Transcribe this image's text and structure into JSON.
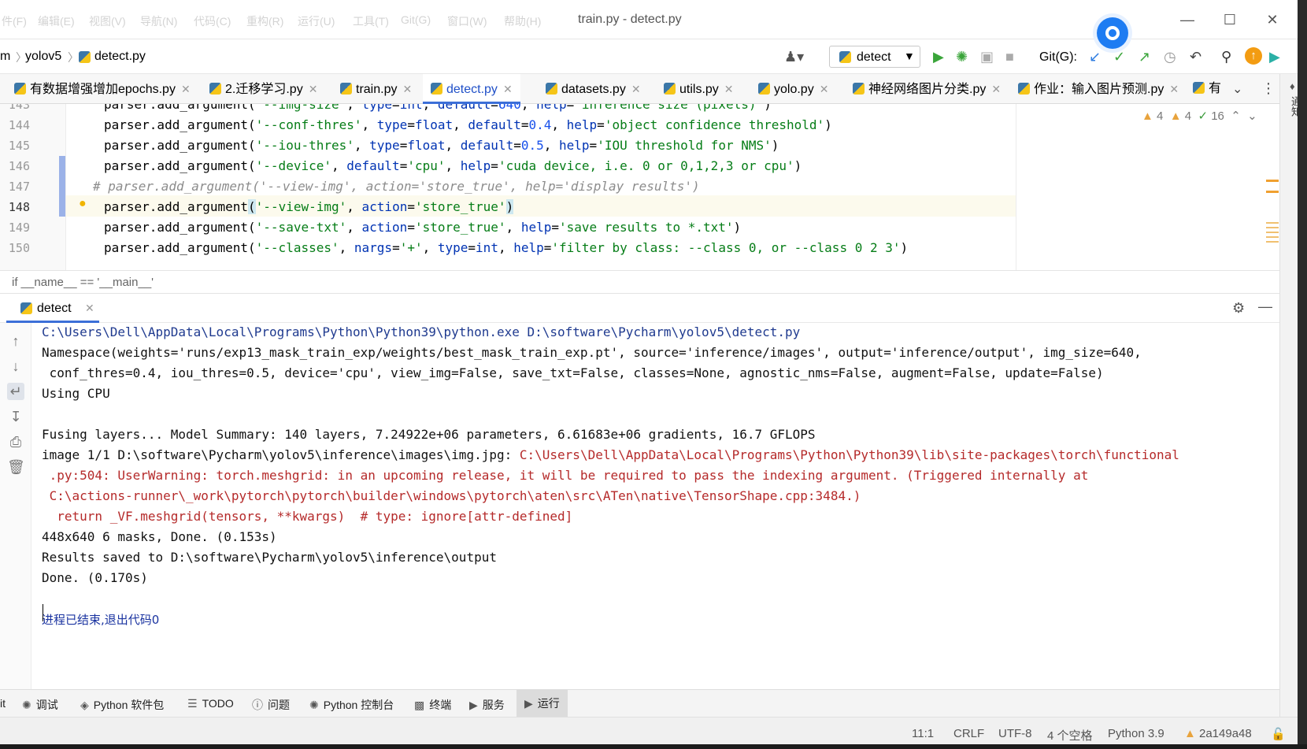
{
  "window": {
    "title": "train.py - detect.py",
    "menu": [
      "件(F)",
      "编辑(E)",
      "视图(V)",
      "导航(N)",
      "代码(C)",
      "重构(R)",
      "运行(U)",
      "工具(T)",
      "Git(G)",
      "窗口(W)",
      "帮助(H)"
    ]
  },
  "navbar": {
    "breadcrumb": [
      "m",
      "yolov5",
      "detect.py"
    ],
    "run_config": "detect",
    "git_label": "Git(G):"
  },
  "tabs": [
    {
      "label": "有数据增强增加epochs.py",
      "active": false
    },
    {
      "label": "2.迁移学习.py",
      "active": false
    },
    {
      "label": "train.py",
      "active": false
    },
    {
      "label": "detect.py",
      "active": true
    },
    {
      "label": "datasets.py",
      "active": false
    },
    {
      "label": "utils.py",
      "active": false
    },
    {
      "label": "yolo.py",
      "active": false
    },
    {
      "label": "神经网络图片分类.py",
      "active": false
    },
    {
      "label": "作业：输入图片预测.py",
      "active": false
    },
    {
      "label": "有",
      "active": false
    }
  ],
  "editor": {
    "line_numbers": [
      "143",
      "144",
      "145",
      "146",
      "147",
      "148",
      "149",
      "150"
    ],
    "inspections": {
      "warnings_a": "4",
      "warnings_b": "4",
      "ok": "16"
    },
    "breadcrumb": "if __name__ == '__main__'"
  },
  "run": {
    "tab_label": "detect",
    "console": {
      "line1": "C:\\Users\\Dell\\AppData\\Local\\Programs\\Python\\Python39\\python.exe D:\\software\\Pycharm\\yolov5\\detect.py",
      "line2": "Namespace(weights='runs/exp13_mask_train_exp/weights/best_mask_train_exp.pt', source='inference/images', output='inference/output', img_size=640,",
      "line3": " conf_thres=0.4, iou_thres=0.5, device='cpu', view_img=False, save_txt=False, classes=None, agnostic_nms=False, augment=False, update=False)",
      "line4": "Using CPU",
      "line5": "Fusing layers... Model Summary: 140 layers, 7.24922e+06 parameters, 6.61683e+06 gradients, 16.7 GFLOPS",
      "line6a": "image 1/1 D:\\software\\Pycharm\\yolov5\\inference\\images\\img.jpg: ",
      "line6b": "C:\\Users\\Dell\\AppData\\Local\\Programs\\Python\\Python39\\lib\\site-packages\\torch\\functional",
      "line7": " .py:504: UserWarning: torch.meshgrid: in an upcoming release, it will be required to pass the indexing argument. (Triggered internally at",
      "line8": " C:\\actions-runner\\_work\\pytorch\\pytorch\\builder\\windows\\pytorch\\aten\\src\\ATen\\native\\TensorShape.cpp:3484.)",
      "line9": "  return _VF.meshgrid(tensors, **kwargs)  # type: ignore[attr-defined]",
      "line10": "448x640 6 masks, Done. (0.153s)",
      "line11": "Results saved to D:\\software\\Pycharm\\yolov5\\inference\\output",
      "line12": "Done. (0.170s)",
      "exit": "进程已结束,退出代码0"
    }
  },
  "tool_tabs": [
    "it",
    "调试",
    "Python 软件包",
    "TODO",
    "问题",
    "Python 控制台",
    "终端",
    "服务",
    "运行"
  ],
  "status": {
    "position": "11:1",
    "line_sep": "CRLF",
    "encoding": "UTF-8",
    "indent": "4 个空格",
    "interpreter": "Python 3.9",
    "git": "2a149a48"
  },
  "right_strip_label": "通知",
  "colors": {
    "accent": "#3c6fd8",
    "error": "#b52a2a",
    "console_blue": "#1f3a8f"
  }
}
